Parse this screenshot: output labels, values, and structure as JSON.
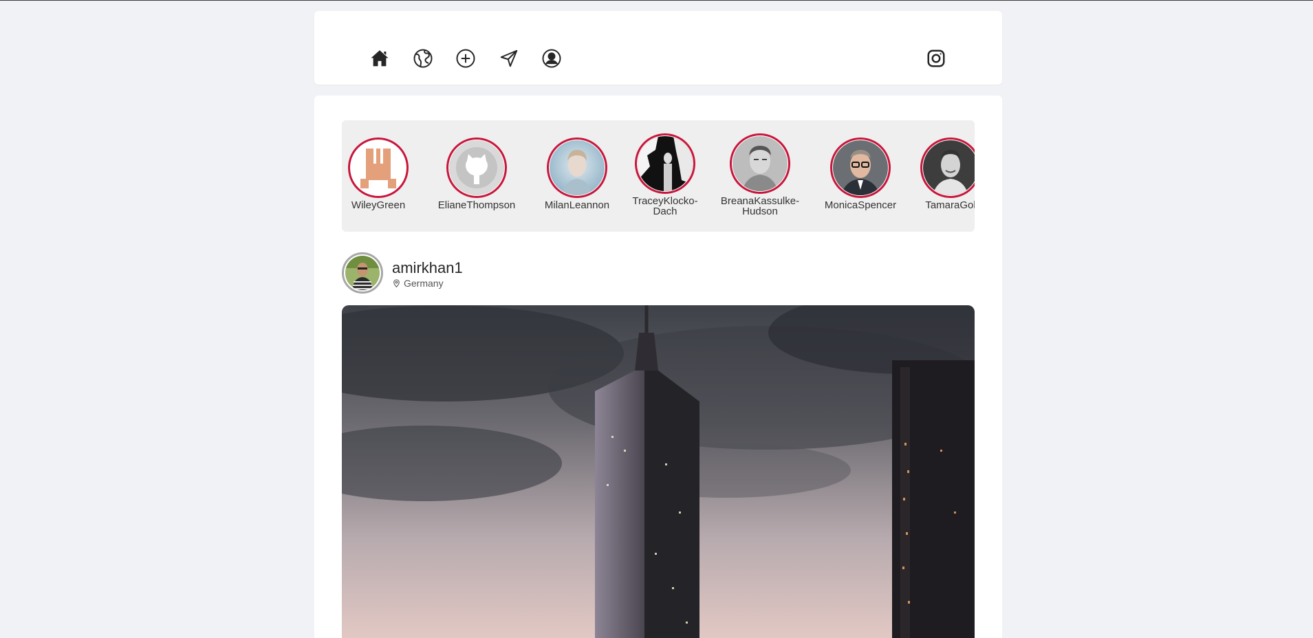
{
  "nav": {
    "icons": [
      "home-icon",
      "explore-globe-icon",
      "create-plus-icon",
      "direct-send-icon",
      "profile-icon"
    ],
    "brand_icon": "instagram-icon"
  },
  "stories": [
    {
      "name": "WileyGreen",
      "avatar": "pixel-robot"
    },
    {
      "name": "ElianeThompson",
      "avatar": "github-octocat"
    },
    {
      "name": "MilanLeannon",
      "avatar": "photo-man-blue"
    },
    {
      "name": "TraceyKlocko-Dach",
      "avatar": "photo-bw-figure"
    },
    {
      "name": "BreanaKassulke-Hudson",
      "avatar": "photo-man-gray"
    },
    {
      "name": "MonicaSpencer",
      "avatar": "photo-man-glasses"
    },
    {
      "name": "TamaraGol",
      "avatar": "photo-man-smiling"
    }
  ],
  "post": {
    "username": "amirkhan1",
    "location": "Germany",
    "location_icon": "map-pin-icon",
    "image": "city-skyscrapers-dusk"
  },
  "colors": {
    "story_ring": "#c8163c",
    "background": "#f0f2f5",
    "card": "#ffffff",
    "stories_bg": "#efefef"
  }
}
